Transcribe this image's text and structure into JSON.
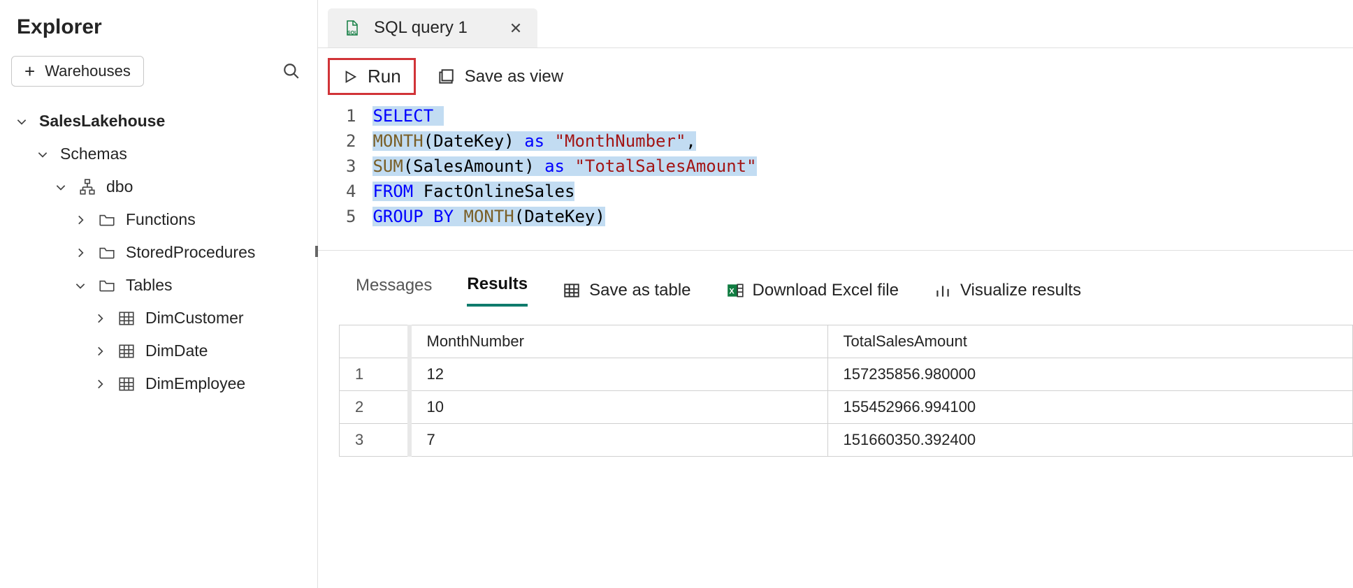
{
  "sidebar": {
    "title": "Explorer",
    "warehouses_button": "Warehouses",
    "tree": {
      "root": "SalesLakehouse",
      "schemas": "Schemas",
      "dbo": "dbo",
      "functions": "Functions",
      "stored_procedures": "StoredProcedures",
      "tables": "Tables",
      "table_items": [
        "DimCustomer",
        "DimDate",
        "DimEmployee"
      ]
    }
  },
  "tab": {
    "label": "SQL query 1"
  },
  "toolbar": {
    "run": "Run",
    "save_as_view": "Save as view"
  },
  "editor": {
    "lines": [
      "1",
      "2",
      "3",
      "4",
      "5"
    ],
    "line1": {
      "a": "SELECT"
    },
    "line2": {
      "a": "MONTH",
      "b": "(DateKey)",
      "c": " as ",
      "d": "\"MonthNumber\"",
      "e": ","
    },
    "line3": {
      "a": "SUM",
      "b": "(SalesAmount)",
      "c": " as ",
      "d": "\"TotalSalesAmount\""
    },
    "line4": {
      "a": "FROM",
      "b": " FactOnlineSales"
    },
    "line5": {
      "a": "GROUP",
      "b": " BY ",
      "c": "MONTH",
      "d": "(DateKey)"
    }
  },
  "results_bar": {
    "messages": "Messages",
    "results": "Results",
    "save_as_table": "Save as table",
    "download_excel": "Download Excel file",
    "visualize": "Visualize results"
  },
  "grid": {
    "headers": [
      "MonthNumber",
      "TotalSalesAmount"
    ],
    "rows": [
      {
        "n": "1",
        "c0": "12",
        "c1": "157235856.980000"
      },
      {
        "n": "2",
        "c0": "10",
        "c1": "155452966.994100"
      },
      {
        "n": "3",
        "c0": "7",
        "c1": "151660350.392400"
      }
    ]
  }
}
